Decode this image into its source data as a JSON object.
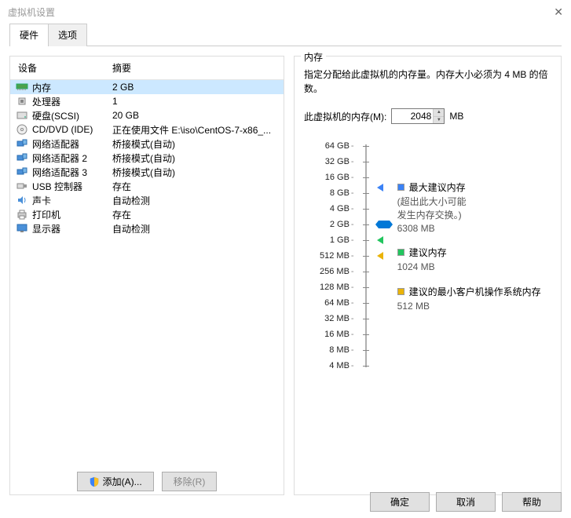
{
  "window": {
    "title": "虚拟机设置"
  },
  "tabs": {
    "hardware": "硬件",
    "options": "选项"
  },
  "hw_table": {
    "header": {
      "device": "设备",
      "summary": "摘要"
    },
    "rows": [
      {
        "device": "内存",
        "summary": "2 GB",
        "icon": "mem"
      },
      {
        "device": "处理器",
        "summary": "1",
        "icon": "cpu"
      },
      {
        "device": "硬盘(SCSI)",
        "summary": "20 GB",
        "icon": "disk"
      },
      {
        "device": "CD/DVD (IDE)",
        "summary": "正在使用文件 E:\\iso\\CentOS-7-x86_...",
        "icon": "cd"
      },
      {
        "device": "网络适配器",
        "summary": "桥接模式(自动)",
        "icon": "net"
      },
      {
        "device": "网络适配器 2",
        "summary": "桥接模式(自动)",
        "icon": "net"
      },
      {
        "device": "网络适配器 3",
        "summary": "桥接模式(自动)",
        "icon": "net"
      },
      {
        "device": "USB 控制器",
        "summary": "存在",
        "icon": "usb"
      },
      {
        "device": "声卡",
        "summary": "自动检测",
        "icon": "sound"
      },
      {
        "device": "打印机",
        "summary": "存在",
        "icon": "printer"
      },
      {
        "device": "显示器",
        "summary": "自动检测",
        "icon": "display"
      }
    ]
  },
  "buttons": {
    "add": "添加(A)...",
    "remove": "移除(R)",
    "ok": "确定",
    "cancel": "取消",
    "help": "帮助"
  },
  "memory": {
    "legend": "内存",
    "desc": "指定分配给此虚拟机的内存量。内存大小必须为 4 MB 的倍数。",
    "label": "此虚拟机的内存(M):",
    "value": "2048",
    "unit": "MB",
    "ticks": [
      "64 GB",
      "32 GB",
      "16 GB",
      "8 GB",
      "4 GB",
      "2 GB",
      "1 GB",
      "512 MB",
      "256 MB",
      "128 MB",
      "64 MB",
      "32 MB",
      "16 MB",
      "8 MB",
      "4 MB"
    ],
    "markers": {
      "max": {
        "title": "最大建议内存",
        "sub1": "(超出此大小可能",
        "sub2": "发生内存交换。)",
        "value": "6308 MB",
        "color": "#3b82f6"
      },
      "rec": {
        "title": "建议内存",
        "value": "1024 MB",
        "color": "#22c55e"
      },
      "min": {
        "title": "建议的最小客户机操作系统内存",
        "value": "512 MB",
        "color": "#eab308"
      }
    }
  }
}
